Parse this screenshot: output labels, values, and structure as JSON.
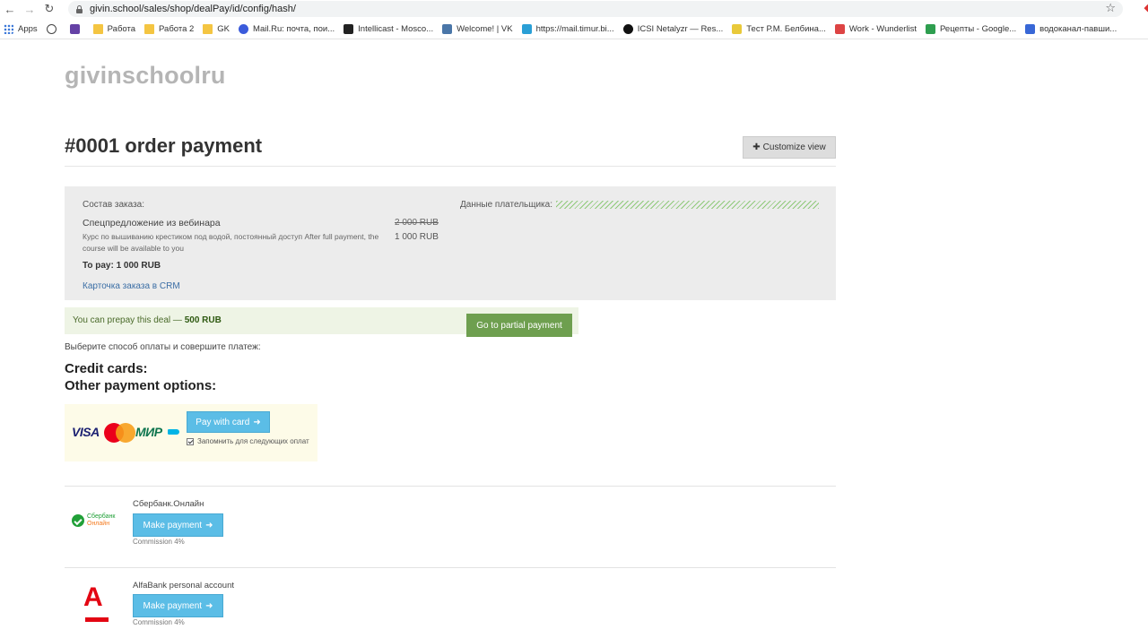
{
  "browser": {
    "url": "givin.school/sales/shop/dealPay/id/config/hash/",
    "bookmarks": [
      {
        "label": "Apps",
        "icon": "apps-grid-icon"
      },
      {
        "label": "",
        "icon": "circle-t-icon"
      },
      {
        "label": "",
        "icon": "twitch-icon"
      },
      {
        "label": "Работа",
        "icon": "folder-icon"
      },
      {
        "label": "Работа 2",
        "icon": "folder-icon"
      },
      {
        "label": "GK",
        "icon": "folder-icon"
      },
      {
        "label": "Mail.Ru: почта, пои...",
        "icon": "mailru-icon"
      },
      {
        "label": "Intellicast - Mosco...",
        "icon": "intellicast-icon"
      },
      {
        "label": "Welcome! | VK",
        "icon": "vk-icon"
      },
      {
        "label": "https://mail.timur.bi...",
        "icon": "envelope-icon"
      },
      {
        "label": "ICSI Netalyzr — Res...",
        "icon": "netalyzr-icon"
      },
      {
        "label": "Тест Р.М. Белбина...",
        "icon": "test-icon"
      },
      {
        "label": "Work - Wunderlist",
        "icon": "wunderlist-icon"
      },
      {
        "label": "Рецепты - Google...",
        "icon": "google-sheets-icon"
      },
      {
        "label": "водоканал-павши...",
        "icon": "doc-icon"
      }
    ]
  },
  "site": {
    "logo": "givinschoolru"
  },
  "order": {
    "title": "#0001 order payment",
    "customize_label": "Customize view",
    "composition_label": "Состав заказа:",
    "payer_label": "Данные плательщика:",
    "item_name": "Спецпредложение из вебинара",
    "item_description": "Курс по вышиванию крестиком под водой, постоянный доступ After full payment, the course will be available to you",
    "old_price": "2 000 RUB",
    "new_price": "1 000 RUB",
    "to_pay": "To pay: 1 000 RUB",
    "crm_link": "Карточка заказа в CRM"
  },
  "prepay": {
    "text": "You can prepay this deal — ",
    "amount": "500 RUB",
    "button_label": "Go to partial payment"
  },
  "payment": {
    "choose_text": "Выберите способ оплаты и совершите платеж:",
    "credit_heading": "Credit cards:",
    "other_heading": "Other payment options:",
    "card": {
      "logos": {
        "visa": "VISA",
        "mir": "МИР"
      },
      "button_label": "Pay with card",
      "remember_label": "Запомнить для следующих оплат",
      "remember_checked": true
    },
    "methods": [
      {
        "name": "Сбербанк.Онлайн",
        "logo_line1": "Сбербанк",
        "logo_line2": "Онлайн",
        "button_label": "Make payment",
        "commission": "Commission 4%"
      },
      {
        "name": "AlfaBank personal account",
        "logo_letter": "А",
        "button_label": "Make payment",
        "commission": "Commission 4%"
      }
    ]
  },
  "colors": {
    "primary_button": "#5bbde6",
    "partial_button": "#6e9f4f",
    "summary_bg": "#ececec",
    "prepay_bg": "#eef4e5",
    "card_box_bg": "#fdfbe8"
  }
}
